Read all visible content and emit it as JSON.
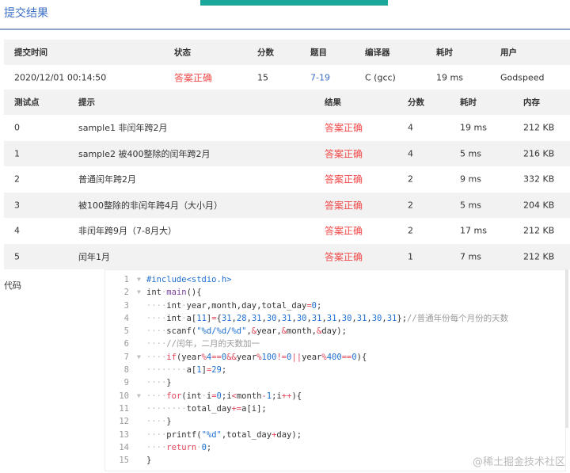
{
  "title": "提交结果",
  "submission": {
    "headers": [
      "提交时间",
      "状态",
      "分数",
      "题目",
      "编译器",
      "耗时",
      "用户"
    ],
    "row": [
      "2020/12/01 00:14:50",
      "答案正确",
      "15",
      "7-19",
      "C (gcc)",
      "19 ms",
      "Godspeed"
    ]
  },
  "tests": {
    "headers": [
      "测试点",
      "提示",
      "结果",
      "分数",
      "耗时",
      "内存"
    ],
    "rows": [
      [
        "0",
        "sample1 非闰年跨2月",
        "答案正确",
        "4",
        "19 ms",
        "212 KB"
      ],
      [
        "1",
        "sample2 被400整除的闰年跨2月",
        "答案正确",
        "4",
        "5 ms",
        "216 KB"
      ],
      [
        "2",
        "普通闰年跨2月",
        "答案正确",
        "2",
        "9 ms",
        "332 KB"
      ],
      [
        "3",
        "被100整除的非闰年跨4月（大小月）",
        "答案正确",
        "2",
        "5 ms",
        "204 KB"
      ],
      [
        "4",
        "非闰年跨9月（7-8月大）",
        "答案正确",
        "2",
        "17 ms",
        "212 KB"
      ],
      [
        "5",
        "闰年1月",
        "答案正确",
        "1",
        "7 ms",
        "212 KB"
      ]
    ]
  },
  "code_label": "代码",
  "code_lines": [
    {
      "fold": true,
      "tokens": [
        [
          "#include<stdio.h>",
          "pp"
        ]
      ]
    },
    {
      "fold": true,
      "tokens": [
        [
          "int",
          "kw"
        ],
        [
          "·",
          "dot"
        ],
        [
          "main",
          "fn"
        ],
        [
          "(){",
          "kw"
        ]
      ]
    },
    {
      "tokens": [
        [
          "····",
          "dot"
        ],
        [
          "int",
          "kw"
        ],
        [
          "·",
          "dot"
        ],
        [
          "year,month,day,total_day",
          "kw"
        ],
        [
          "=",
          "op"
        ],
        [
          "0",
          "num"
        ],
        [
          ";",
          "kw"
        ]
      ]
    },
    {
      "tokens": [
        [
          "····",
          "dot"
        ],
        [
          "int",
          "kw"
        ],
        [
          "·",
          "dot"
        ],
        [
          "a[",
          "kw"
        ],
        [
          "11",
          "num"
        ],
        [
          "]",
          "kw"
        ],
        [
          "=",
          "op"
        ],
        [
          "{",
          "kw"
        ],
        [
          "31",
          "num"
        ],
        [
          ",",
          "kw"
        ],
        [
          "28",
          "num"
        ],
        [
          ",",
          "kw"
        ],
        [
          "31",
          "num"
        ],
        [
          ",",
          "kw"
        ],
        [
          "30",
          "num"
        ],
        [
          ",",
          "kw"
        ],
        [
          "31",
          "num"
        ],
        [
          ",",
          "kw"
        ],
        [
          "30",
          "num"
        ],
        [
          ",",
          "kw"
        ],
        [
          "31",
          "num"
        ],
        [
          ",",
          "kw"
        ],
        [
          "31",
          "num"
        ],
        [
          ",",
          "kw"
        ],
        [
          "30",
          "num"
        ],
        [
          ",",
          "kw"
        ],
        [
          "31",
          "num"
        ],
        [
          ",",
          "kw"
        ],
        [
          "30",
          "num"
        ],
        [
          ",",
          "kw"
        ],
        [
          "31",
          "num"
        ],
        [
          "};",
          "kw"
        ],
        [
          "//普通年份每个月份的天数",
          "cm"
        ]
      ]
    },
    {
      "tokens": [
        [
          "····",
          "dot"
        ],
        [
          "scanf(",
          "kw"
        ],
        [
          "\"%d/%d/%d\"",
          "str"
        ],
        [
          ",",
          "kw"
        ],
        [
          "&",
          "op"
        ],
        [
          "year,",
          "kw"
        ],
        [
          "&",
          "op"
        ],
        [
          "month,",
          "kw"
        ],
        [
          "&",
          "op"
        ],
        [
          "day);",
          "kw"
        ]
      ]
    },
    {
      "tokens": [
        [
          "····",
          "dot"
        ],
        [
          "//闰年，二月的天数加一",
          "cm"
        ]
      ]
    },
    {
      "fold": true,
      "tokens": [
        [
          "····",
          "dot"
        ],
        [
          "if",
          "ctl"
        ],
        [
          "(year",
          "kw"
        ],
        [
          "%",
          "op"
        ],
        [
          "4",
          "num"
        ],
        [
          "==",
          "op"
        ],
        [
          "0",
          "num"
        ],
        [
          "&&",
          "op"
        ],
        [
          "year",
          "kw"
        ],
        [
          "%",
          "op"
        ],
        [
          "100",
          "num"
        ],
        [
          "!=",
          "op"
        ],
        [
          "0",
          "num"
        ],
        [
          "||",
          "op"
        ],
        [
          "year",
          "kw"
        ],
        [
          "%",
          "op"
        ],
        [
          "400",
          "num"
        ],
        [
          "==",
          "op"
        ],
        [
          "0",
          "num"
        ],
        [
          "){",
          "kw"
        ]
      ]
    },
    {
      "tokens": [
        [
          "········",
          "dot"
        ],
        [
          "a[",
          "kw"
        ],
        [
          "1",
          "num"
        ],
        [
          "]",
          "kw"
        ],
        [
          "=",
          "op"
        ],
        [
          "29",
          "num"
        ],
        [
          ";",
          "kw"
        ]
      ]
    },
    {
      "tokens": [
        [
          "····",
          "dot"
        ],
        [
          "}",
          "kw"
        ]
      ]
    },
    {
      "fold": true,
      "tokens": [
        [
          "····",
          "dot"
        ],
        [
          "for",
          "ctl"
        ],
        [
          "(",
          "kw"
        ],
        [
          "int",
          "kw"
        ],
        [
          "·",
          "dot"
        ],
        [
          "i",
          "kw"
        ],
        [
          "=",
          "op"
        ],
        [
          "0",
          "num"
        ],
        [
          ";i",
          "kw"
        ],
        [
          "<",
          "op"
        ],
        [
          "month",
          "kw"
        ],
        [
          "-",
          "op"
        ],
        [
          "1",
          "num"
        ],
        [
          ";i",
          "kw"
        ],
        [
          "++",
          "op"
        ],
        [
          "){",
          "kw"
        ]
      ]
    },
    {
      "tokens": [
        [
          "········",
          "dot"
        ],
        [
          "total_day",
          "kw"
        ],
        [
          "+=",
          "op"
        ],
        [
          "a[i];",
          "kw"
        ]
      ]
    },
    {
      "tokens": [
        [
          "····",
          "dot"
        ],
        [
          "}",
          "kw"
        ]
      ]
    },
    {
      "tokens": [
        [
          "····",
          "dot"
        ],
        [
          "printf(",
          "kw"
        ],
        [
          "\"%d\"",
          "str"
        ],
        [
          ",total_day",
          "kw"
        ],
        [
          "+",
          "op"
        ],
        [
          "day);",
          "kw"
        ]
      ]
    },
    {
      "tokens": [
        [
          "····",
          "dot"
        ],
        [
          "return",
          "ctl"
        ],
        [
          "·",
          "dot"
        ],
        [
          "0",
          "num"
        ],
        [
          ";",
          "kw"
        ]
      ]
    },
    {
      "tokens": [
        [
          "}",
          "kw"
        ]
      ]
    }
  ],
  "watermark": "@稀土掘金技术社区"
}
